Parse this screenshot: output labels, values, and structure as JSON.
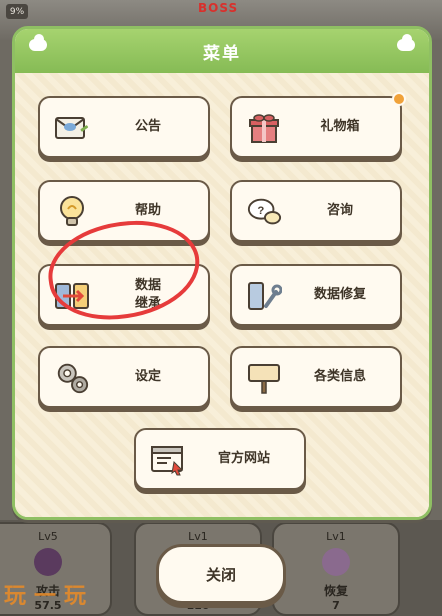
{
  "background": {
    "boss_label": "BOSS",
    "progress_badge": "9%",
    "stats": [
      {
        "level": "Lv5",
        "name": "攻击",
        "value": "57.5"
      },
      {
        "level": "Lv1",
        "name": "",
        "value": "110"
      },
      {
        "level": "Lv1",
        "name": "恢复",
        "value": "7"
      }
    ]
  },
  "menu": {
    "title": "菜单",
    "buttons": {
      "notice": "公告",
      "giftbox": "礼物箱",
      "help": "帮助",
      "consult": "咨询",
      "data_transfer_line1": "数据",
      "data_transfer_line2": "继承",
      "data_repair": "数据修复",
      "settings": "设定",
      "info": "各类信息",
      "website": "官方网站"
    },
    "close": "关闭"
  },
  "watermark": "玩一玩",
  "colors": {
    "header_green": "#8fc25d",
    "panel_cream": "#fbf5e6",
    "button_border": "#6a5a47",
    "highlight_red": "#e63b3b",
    "badge_orange": "#f0a23a"
  }
}
